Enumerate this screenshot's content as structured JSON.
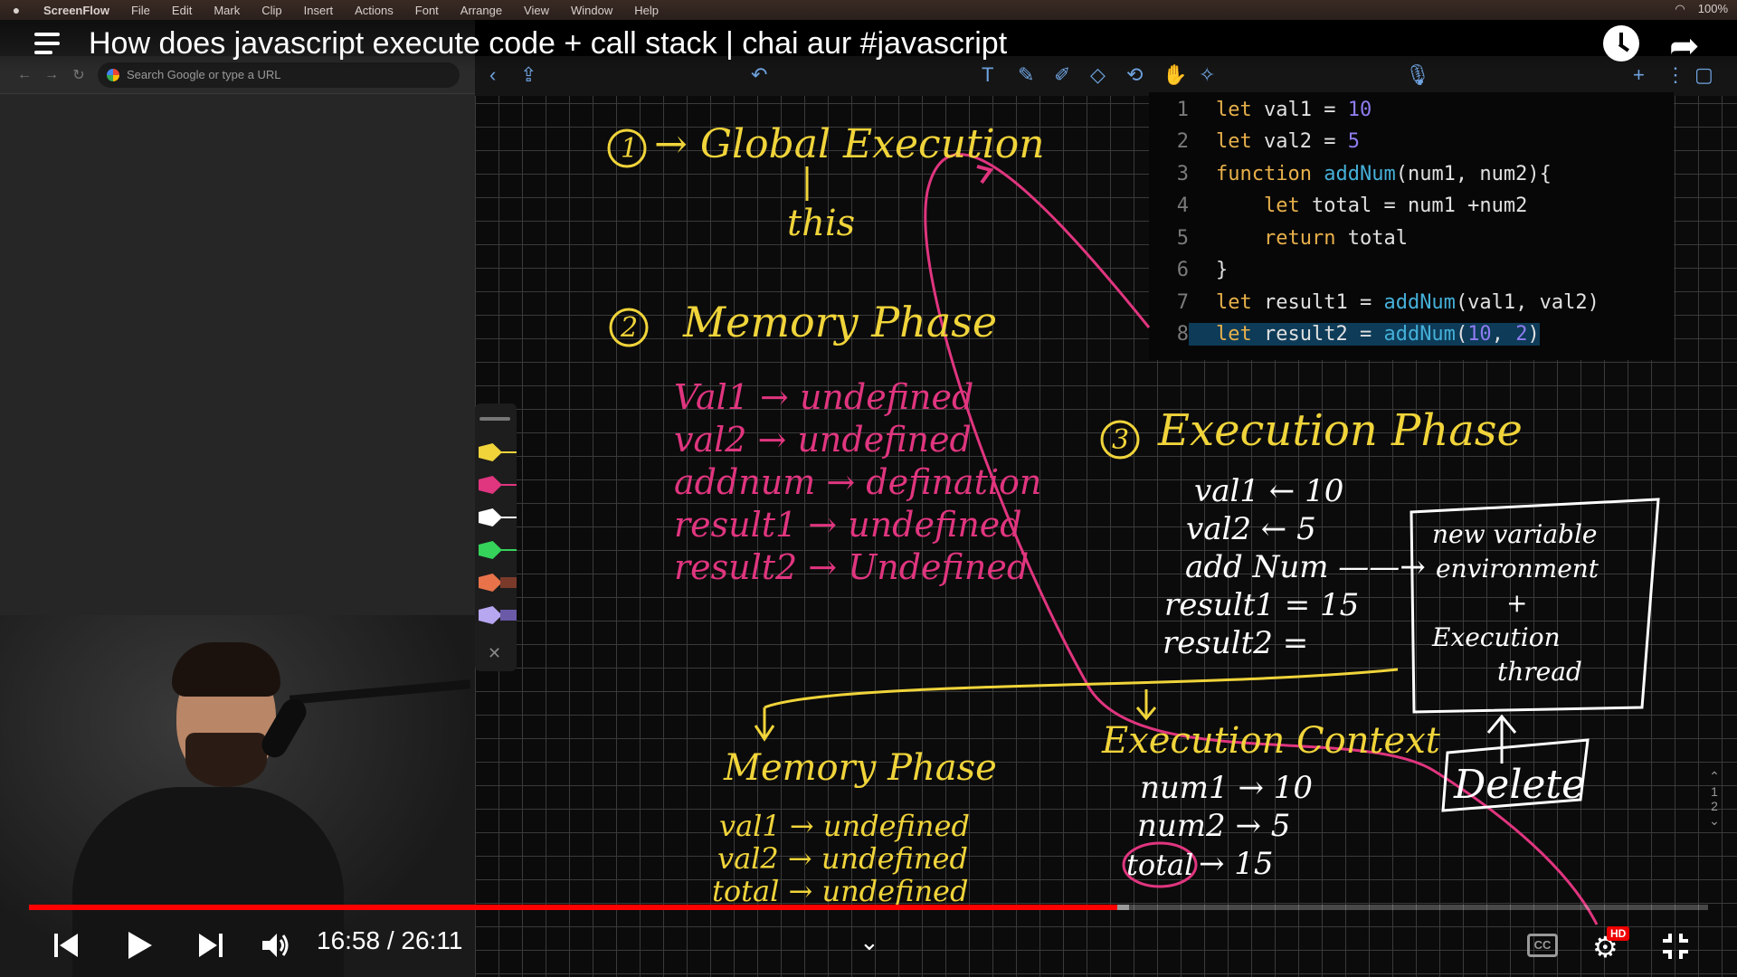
{
  "menubar": {
    "apple": "",
    "items": [
      "ScreenFlow",
      "File",
      "Edit",
      "Mark",
      "Clip",
      "Insert",
      "Actions",
      "Font",
      "Arrange",
      "View",
      "Window",
      "Help"
    ],
    "battery": "100%"
  },
  "browser": {
    "omnibox_placeholder": "Search Google or type a URL"
  },
  "video": {
    "title": "How does javascript execute code + call stack | chai aur #javascript",
    "current_time": "16:58",
    "duration": "26:11",
    "time_display": "16:58 / 26:11",
    "progress_fraction": 0.648,
    "buffered_fraction": 0.655,
    "hd_badge": "HD",
    "cc_label": "CC"
  },
  "code": {
    "lines": [
      {
        "n": "1",
        "parts": [
          [
            "kw",
            "let"
          ],
          [
            "t",
            " val1 = "
          ],
          [
            "num",
            "10"
          ]
        ]
      },
      {
        "n": "2",
        "parts": [
          [
            "kw",
            "let"
          ],
          [
            "t",
            " val2 = "
          ],
          [
            "num",
            "5"
          ]
        ]
      },
      {
        "n": "3",
        "parts": [
          [
            "kw",
            "function"
          ],
          [
            "t",
            " "
          ],
          [
            "fn",
            "addNum"
          ],
          [
            "t",
            "(num1, num2){"
          ]
        ]
      },
      {
        "n": "4",
        "parts": [
          [
            "t",
            "    "
          ],
          [
            "kw",
            "let"
          ],
          [
            "t",
            " total = num1 +num2"
          ]
        ]
      },
      {
        "n": "5",
        "parts": [
          [
            "t",
            "    "
          ],
          [
            "kw",
            "return"
          ],
          [
            "t",
            " total"
          ]
        ]
      },
      {
        "n": "6",
        "parts": [
          [
            "t",
            "}"
          ]
        ]
      },
      {
        "n": "7",
        "parts": [
          [
            "kw",
            "let"
          ],
          [
            "t",
            " result1 = "
          ],
          [
            "fn",
            "addNum"
          ],
          [
            "t",
            "(val1, val2)"
          ]
        ]
      },
      {
        "n": "8",
        "parts": [
          [
            "kw",
            "let"
          ],
          [
            "t",
            " result2 = "
          ],
          [
            "fn",
            "addNum"
          ],
          [
            "t",
            "("
          ],
          [
            "num",
            "10"
          ],
          [
            "t",
            ", "
          ],
          [
            "num",
            "2"
          ],
          [
            "t",
            ")"
          ]
        ],
        "highlight": true
      }
    ]
  },
  "notes": {
    "global_num": "1",
    "global": "→ Global Execution",
    "this": "this",
    "memory_num": "2",
    "memory_title": "Memory Phase",
    "memory_items": [
      "Val1 → undefined",
      "val2 → undefined",
      "addnum → defination",
      "result1 → undefined",
      "result2 → Undefined"
    ],
    "exec_num": "3",
    "exec_title": "Execution Phase",
    "exec_items": [
      "val1 ← 10",
      "val2 ← 5",
      "add Num ——→",
      "result1 = 15",
      "result2 ="
    ],
    "box_lines": [
      "new variable",
      "environment",
      "+",
      "Execution",
      "thread"
    ],
    "delete": "Delete",
    "context_title": "Execution Context",
    "context_items": [
      "num1 → 10",
      "num2 → 5",
      "→ 15"
    ],
    "context_total": "total",
    "sub_memory_title": "Memory Phase",
    "sub_memory_items": [
      "val1 → undefined",
      "val2 → undefined",
      "total → undefined"
    ]
  },
  "colors": {
    "yellow": "#f0d43a",
    "pink": "#e0357f",
    "white": "#ffffff",
    "player_red": "#ff0000"
  },
  "right_rail": [
    "1",
    "2"
  ]
}
